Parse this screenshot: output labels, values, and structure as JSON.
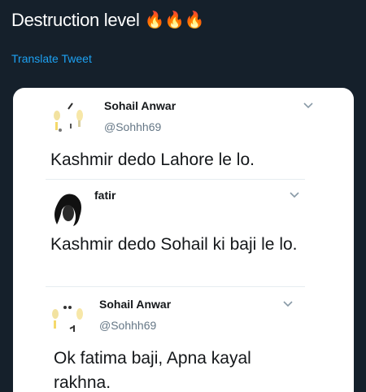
{
  "tweet": {
    "text": "Destruction level",
    "emoji": "🔥🔥🔥",
    "translate_label": "Translate Tweet"
  },
  "replies": [
    {
      "name": "Sohail Anwar",
      "handle": "@Sohhh69",
      "text": "Kashmir dedo Lahore le lo."
    },
    {
      "name": "fatir",
      "handle": "",
      "text": "Kashmir dedo Sohail ki baji le lo."
    },
    {
      "name": "Sohail Anwar",
      "handle": "@Sohhh69",
      "text": "Ok fatima baji, Apna kayal rakhna."
    }
  ],
  "colors": {
    "background": "#15202b",
    "link": "#1da1f2",
    "card": "#ffffff"
  }
}
